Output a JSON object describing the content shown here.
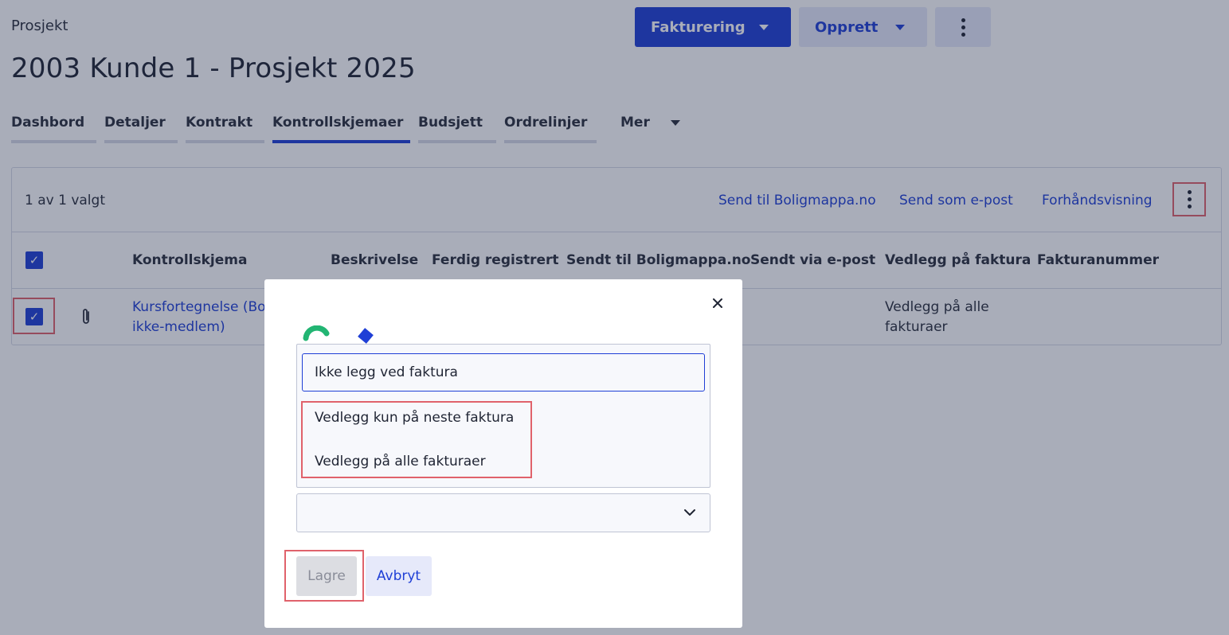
{
  "header": {
    "breadcrumb": "Prosjekt",
    "title": "2003 Kunde 1 - Prosjekt 2025",
    "fakturering_label": "Fakturering",
    "opprett_label": "Opprett"
  },
  "tabs": [
    {
      "label": "Dashbord"
    },
    {
      "label": "Detaljer"
    },
    {
      "label": "Kontrakt"
    },
    {
      "label": "Kontrollskjemaer",
      "active": true
    },
    {
      "label": "Budsjett"
    },
    {
      "label": "Ordrelinjer"
    },
    {
      "label": "Mer"
    }
  ],
  "table": {
    "selection_count": "1 av 1 valgt",
    "actions": {
      "send_boligmappa": "Send til Boligmappa.no",
      "send_epost": "Send som e-post",
      "preview": "Forhåndsvisning"
    },
    "columns": [
      "Kontrollskjema",
      "Beskrivelse",
      "Ferdig registrert",
      "Sendt til Boligmappa.no",
      "Sendt via e-post",
      "Vedlegg på faktura",
      "Fakturanummer"
    ],
    "row": {
      "kontrollskjema_line1": "Kursfortegnelse (Bo",
      "kontrollskjema_line2": "ikke-medlem)",
      "vedlegg_line1": "Vedlegg på alle",
      "vedlegg_line2": "fakturaer"
    }
  },
  "modal": {
    "dropdown": {
      "selected": "Ikke legg ved faktura",
      "options": [
        "Vedlegg kun på neste faktura",
        "Vedlegg på alle fakturaer"
      ]
    },
    "select_value": "",
    "save_label": "Lagre",
    "cancel_label": "Avbryt"
  },
  "colors": {
    "accent": "#1f3fd6",
    "highlight": "#e0626b",
    "logo_green": "#22b573"
  }
}
